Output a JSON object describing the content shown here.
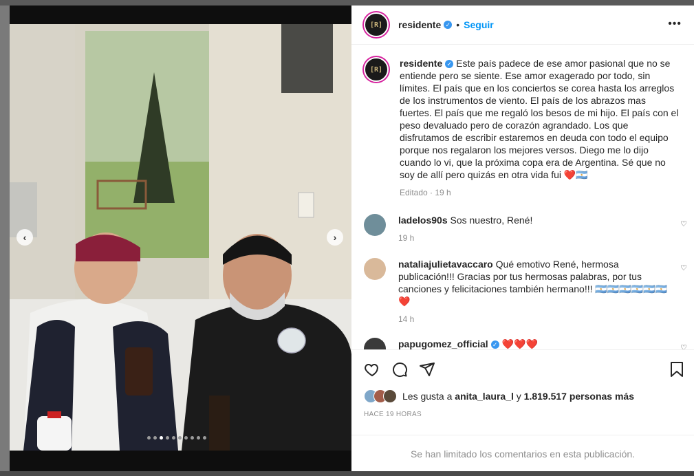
{
  "post": {
    "username": "residente",
    "avatar_text": "[R]",
    "verified": true,
    "separator": "•",
    "follow_label": "Seguir",
    "more_icon": "more-options-icon",
    "carousel": {
      "count": 10,
      "active_index": 2
    },
    "caption": {
      "username": "residente",
      "text": "Este país padece de ese amor pasional que no se entiende pero se siente. Ese amor exagerado por todo, sin límites. El país que en los conciertos se corea hasta los arreglos de los instrumentos de viento. El país de los abrazos mas fuertes. El país que me regaló los besos de mi hijo. El país con el peso devaluado pero de corazón agrandado. Los que disfrutamos de escribir estaremos en deuda con todo el equipo porque nos regalaron los mejores versos. Diego me lo dijo cuando lo vi, que la próxima copa era de Argentina. Sé que no soy de allí pero quizás en otra vida fui ❤️🇦🇷",
      "edited": "Editado · 19 h"
    },
    "comments": [
      {
        "username": "ladelos90s",
        "text": "Sos nuestro, René!",
        "time": "19 h"
      },
      {
        "username": "nataliajulietavaccaro",
        "text": "Qué emotivo René, hermosa publicación!!! Gracias por tus hermosas palabras, por tus canciones y felicitaciones también hermano!!! 🇦🇷🇦🇷🇦🇷🇦🇷🇦🇷🇦🇷❤️",
        "time": "14 h"
      },
      {
        "username": "papugomez_official",
        "text": "❤️❤️❤️",
        "time": ""
      }
    ],
    "likes": {
      "prefix": "Les gusta a",
      "user": "anita_laura_l",
      "conj": "y",
      "count": "1.819.517 personas más"
    },
    "time_ago": "HACE 19 HORAS",
    "comments_limited": "Se han limitado los comentarios en esta publicación."
  },
  "colors": {
    "accent": "#0095f6",
    "verified": "#3897f0",
    "text": "#262626",
    "muted": "#8e8e8e"
  }
}
